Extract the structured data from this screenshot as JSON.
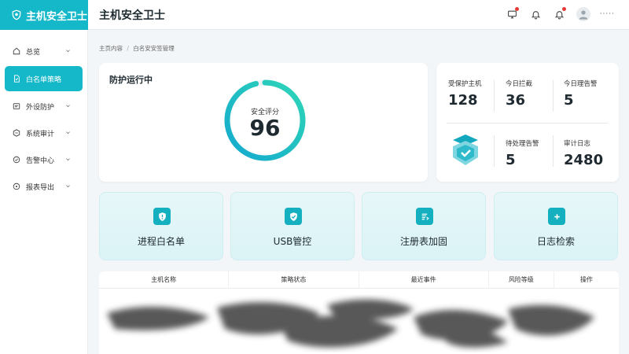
{
  "app": {
    "brand": "主机安全卫士",
    "title": "主机安全卫士",
    "user_name": "·····"
  },
  "header_icons": [
    "monitor-icon",
    "bell-outline-icon",
    "notification-bell-icon"
  ],
  "sidebar": {
    "items": [
      {
        "label": "总览",
        "icon": "home-icon",
        "active": false,
        "chevron": true
      },
      {
        "label": "白名单策略",
        "icon": "whitelist-icon",
        "active": true,
        "chevron": false
      },
      {
        "label": "外设防护",
        "icon": "device-icon",
        "active": false,
        "chevron": true
      },
      {
        "label": "系统审计",
        "icon": "audit-icon",
        "active": false,
        "chevron": true
      },
      {
        "label": "告警中心",
        "icon": "alert-icon",
        "active": false,
        "chevron": true
      },
      {
        "label": "报表导出",
        "icon": "export-icon",
        "active": false,
        "chevron": true
      }
    ]
  },
  "breadcrumb": {
    "root": "主页内容",
    "separator": "/",
    "current": "白名安安签管理"
  },
  "protection": {
    "title": "防护运行中",
    "score_label": "安全评分",
    "score": "96",
    "score_fraction": 0.96
  },
  "stats": {
    "protected_hosts": {
      "label": "受保护主机",
      "value": "128"
    },
    "blocked_today": {
      "label": "今日拦截",
      "value": "36"
    },
    "alerts_today": {
      "label": "今日理告警",
      "value": "5"
    },
    "pending_alerts": {
      "label": "待处理告警",
      "value": "5"
    },
    "audit_logs": {
      "label": "审计日志",
      "value": "2480"
    }
  },
  "features": [
    {
      "label": "进程白名单",
      "icon": "shield-alert-icon"
    },
    {
      "label": "USB管控",
      "icon": "shield-check-icon"
    },
    {
      "label": "注册表加固",
      "icon": "registry-list-icon"
    },
    {
      "label": "日志检索",
      "icon": "log-add-icon"
    }
  ],
  "table": {
    "columns": [
      "主机名称",
      "策略状态",
      "最近事件",
      "风险等级",
      "操作"
    ]
  },
  "colors": {
    "accent": "#14b8c8",
    "gauge_start": "#14a9cf",
    "gauge_end": "#2fd6b7"
  }
}
